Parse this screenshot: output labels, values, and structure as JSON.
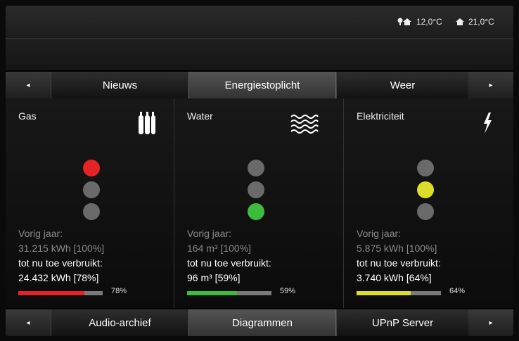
{
  "status": {
    "outdoor_temp": "12,0°C",
    "indoor_temp": "21,0°C"
  },
  "top_tabs": {
    "left_arrow": "◂",
    "right_arrow": "▸",
    "tabs": [
      "Nieuws",
      "Energiestoplicht",
      "Weer"
    ],
    "active": "Energiestoplicht"
  },
  "panels": [
    {
      "title": "Gas",
      "icon": "gas-cylinders-icon",
      "light": "red",
      "prev_label": "Vorig jaar:",
      "prev_value": "31.215 kWh [100%]",
      "used_label": "tot nu toe verbruikt:",
      "used_value": "24.432 kWh [78%]",
      "progress": 78,
      "progress_label": "78%",
      "color": "#e42424"
    },
    {
      "title": "Water",
      "icon": "water-waves-icon",
      "light": "green",
      "prev_label": "Vorig jaar:",
      "prev_value": "164 m³ [100%]",
      "used_label": "tot nu toe verbruikt:",
      "used_value": "96 m³ [59%]",
      "progress": 59,
      "progress_label": "59%",
      "color": "#3dbb3d"
    },
    {
      "title": "Elektriciteit",
      "icon": "lightning-icon",
      "light": "yellow",
      "prev_label": "Vorig jaar:",
      "prev_value": "5.875 kWh [100%]",
      "used_label": "tot nu toe verbruikt:",
      "used_value": "3.740 kWh [64%]",
      "progress": 64,
      "progress_label": "64%",
      "color": "#dcdc2a"
    }
  ],
  "bottom_tabs": {
    "left_arrow": "◂",
    "right_arrow": "▸",
    "tabs": [
      "Audio-archief",
      "Diagrammen",
      "UPnP Server"
    ],
    "active": "Diagrammen"
  }
}
